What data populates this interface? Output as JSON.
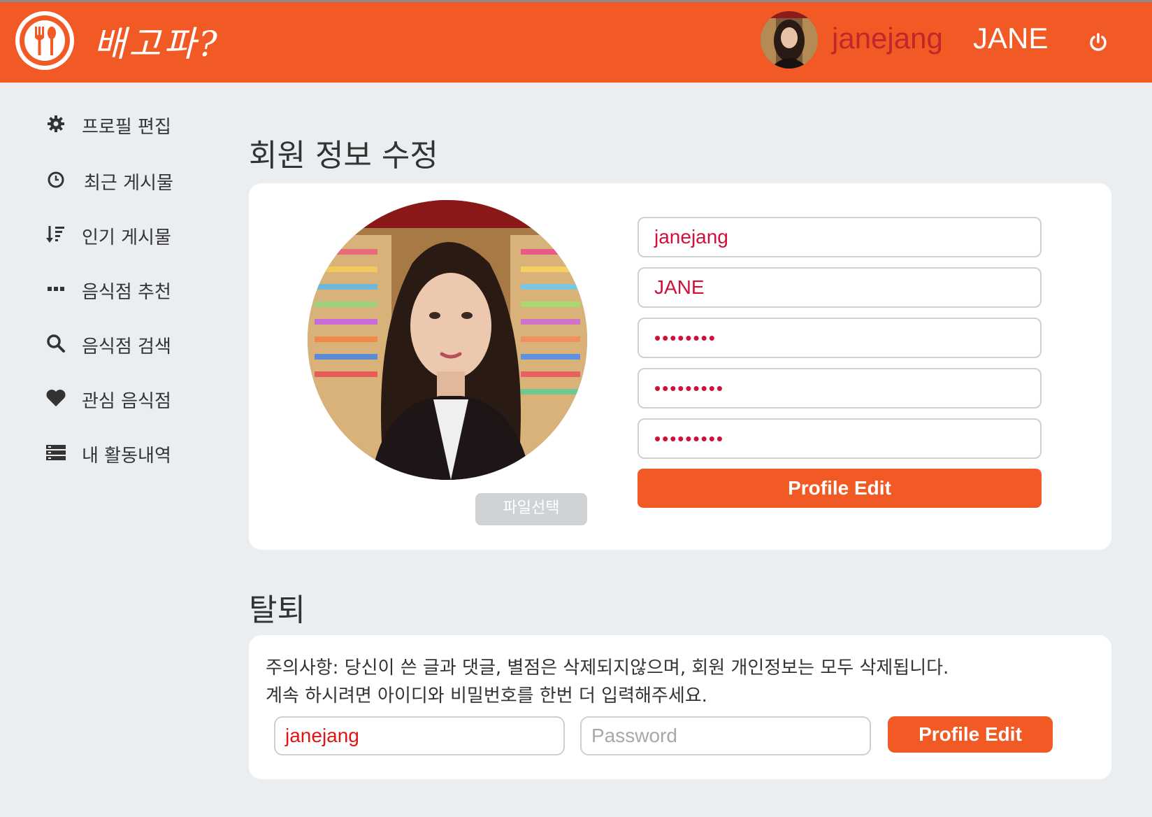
{
  "header": {
    "brand": "배고파?",
    "username": "janejang",
    "display_name": "JANE"
  },
  "sidebar": {
    "items": [
      {
        "label": "프로필 편집",
        "icon": "gear-icon"
      },
      {
        "label": "최근 게시물",
        "icon": "clock-icon"
      },
      {
        "label": "인기 게시물",
        "icon": "sort-icon"
      },
      {
        "label": "음식점 추천",
        "icon": "ellipsis-icon"
      },
      {
        "label": "음식점 검색",
        "icon": "search-icon"
      },
      {
        "label": "관심 음식점",
        "icon": "heart-icon"
      },
      {
        "label": "내 활동내역",
        "icon": "list-icon"
      }
    ]
  },
  "profile": {
    "title": "회원 정보 수정",
    "file_button": "파일선택",
    "fields": {
      "username": "janejang",
      "name": "JANE",
      "password": "••••••••",
      "new_password": "•••••••••",
      "confirm_password": "•••••••••"
    },
    "submit_label": "Profile Edit"
  },
  "withdraw": {
    "title": "탈퇴",
    "notice_line1": "주의사항: 당신이 쓴 글과 댓글, 별점은 삭제되지않으며, 회원 개인정보는 모두 삭제됩니다.",
    "notice_line2": "계속 하시려면 아이디와 비밀번호를 한번 더 입력해주세요.",
    "id_value": "janejang",
    "password_placeholder": "Password",
    "submit_label": "Profile Edit"
  },
  "colors": {
    "accent": "#f15a24",
    "input_text": "#d0103a",
    "background": "#ebeef0"
  }
}
